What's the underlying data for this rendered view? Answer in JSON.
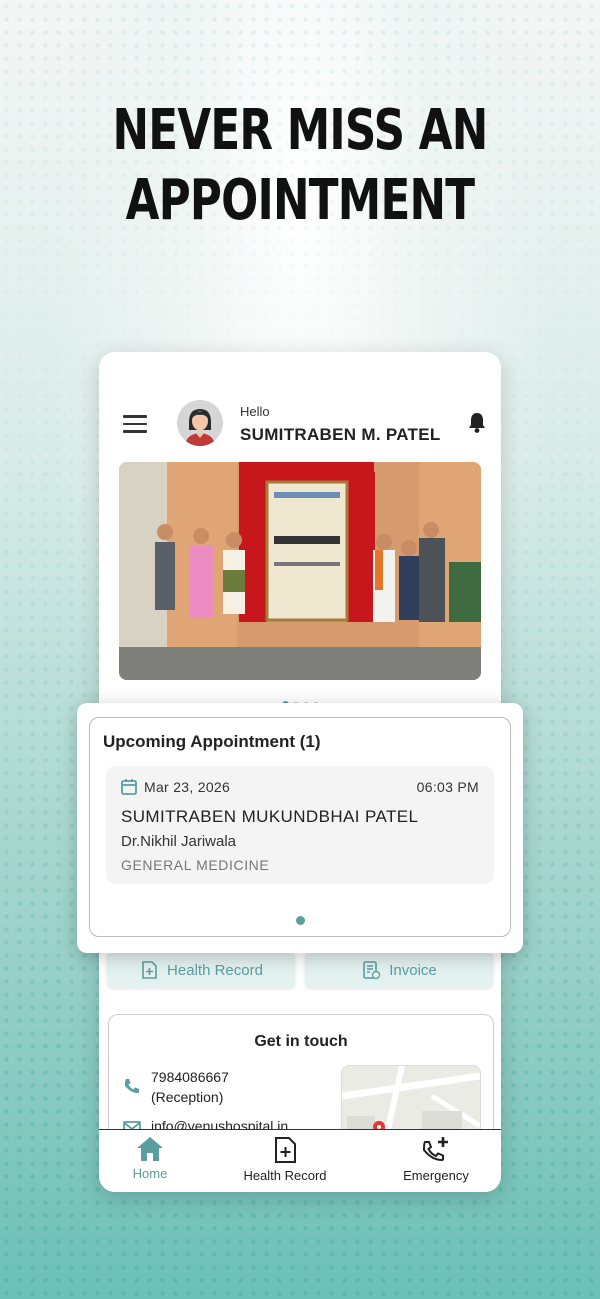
{
  "headline": {
    "line1": "NEVER MISS AN",
    "line2": "APPOINTMENT"
  },
  "header": {
    "greeting": "Hello",
    "user_name": "SUMITRABEN M. PATEL"
  },
  "banner": {
    "pages": 4,
    "active_page": 1
  },
  "appointments": {
    "title": "Upcoming Appointment (1)",
    "items": [
      {
        "date": "Mar 23, 2026",
        "time": "06:03 PM",
        "patient": "SUMITRABEN MUKUNDBHAI PATEL",
        "doctor": "Dr.Nikhil Jariwala",
        "department": "GENERAL MEDICINE"
      }
    ]
  },
  "quick_actions": {
    "health_record": "Health Record",
    "invoice": "Invoice"
  },
  "contact": {
    "title": "Get in touch",
    "phone_line1": "7984086667",
    "phone_line2": "(Reception)",
    "email": "info@venushospital.in"
  },
  "bottom_nav": {
    "home": "Home",
    "health_record": "Health Record",
    "emergency": "Emergency"
  },
  "colors": {
    "accent": "#5a9ea0",
    "bg_teal": "#6cc0b6"
  },
  "icons": [
    "menu-icon",
    "bell-icon",
    "calendar-icon",
    "phone-icon",
    "mail-icon",
    "home-icon",
    "health-record-icon",
    "emergency-icon",
    "invoice-icon"
  ]
}
